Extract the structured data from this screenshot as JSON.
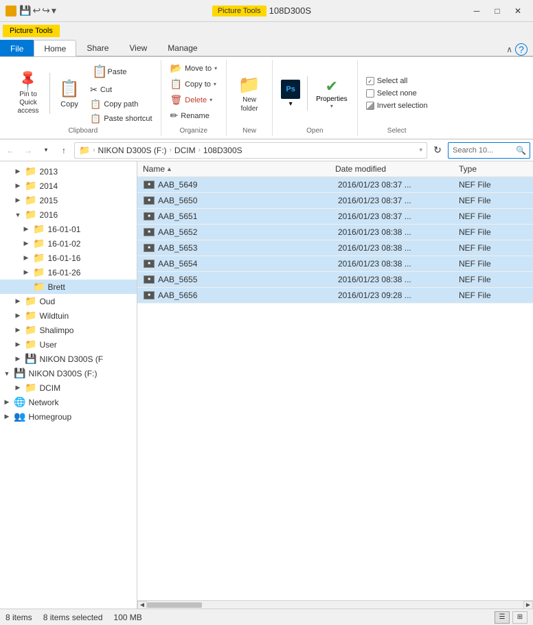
{
  "titlebar": {
    "title": "108D300S",
    "ribbon_label": "Picture Tools",
    "minimize": "─",
    "maximize": "□",
    "close": "✕"
  },
  "ribbon": {
    "tabs": [
      {
        "label": "File",
        "id": "file",
        "type": "file"
      },
      {
        "label": "Home",
        "id": "home",
        "type": "active"
      },
      {
        "label": "Share",
        "id": "share",
        "type": "normal"
      },
      {
        "label": "View",
        "id": "view",
        "type": "normal"
      },
      {
        "label": "Manage",
        "id": "manage",
        "type": "normal"
      }
    ],
    "picture_tools_label": "Picture Tools",
    "groups": {
      "clipboard": {
        "label": "Clipboard",
        "pin_label": "Pin to Quick\naccess",
        "copy_label": "Copy",
        "paste_label": "Paste",
        "cut_label": "Cut",
        "copy_path_label": "Copy path",
        "paste_shortcut_label": "Paste shortcut"
      },
      "organize": {
        "label": "Organize",
        "move_to_label": "Move to",
        "copy_to_label": "Copy to",
        "delete_label": "Delete",
        "rename_label": "Rename"
      },
      "new": {
        "label": "New",
        "new_folder_label": "New\nfolder"
      },
      "open": {
        "label": "Open",
        "properties_label": "Properties"
      },
      "select": {
        "label": "Select",
        "select_all": "Select all",
        "select_none": "Select none",
        "invert_selection": "Invert selection"
      }
    }
  },
  "addressbar": {
    "back_disabled": true,
    "forward_disabled": true,
    "up_label": "Up",
    "path": [
      {
        "label": "NIKON D300S (F:)"
      },
      {
        "label": "DCIM"
      },
      {
        "label": "108D300S"
      }
    ],
    "search_placeholder": "Search 10...",
    "search_icon": "🔍",
    "refresh_icon": "↻"
  },
  "sidebar": {
    "items": [
      {
        "id": "2013",
        "label": "2013",
        "indent": 1,
        "expanded": false,
        "icon": "📁"
      },
      {
        "id": "2014",
        "label": "2014",
        "indent": 1,
        "expanded": false,
        "icon": "📁"
      },
      {
        "id": "2015",
        "label": "2015",
        "indent": 1,
        "expanded": false,
        "icon": "📁"
      },
      {
        "id": "2016",
        "label": "2016",
        "indent": 1,
        "expanded": true,
        "icon": "📁"
      },
      {
        "id": "16-01-01",
        "label": "16-01-01",
        "indent": 2,
        "expanded": false,
        "icon": "📁",
        "color": "orange"
      },
      {
        "id": "16-01-02",
        "label": "16-01-02",
        "indent": 2,
        "expanded": false,
        "icon": "📁",
        "color": "orange"
      },
      {
        "id": "16-01-16",
        "label": "16-01-16",
        "indent": 2,
        "expanded": false,
        "icon": "📁",
        "color": "orange"
      },
      {
        "id": "16-01-26",
        "label": "16-01-26",
        "indent": 2,
        "expanded": false,
        "icon": "📁",
        "color": "orange"
      },
      {
        "id": "Brett",
        "label": "Brett",
        "indent": 2,
        "expanded": false,
        "icon": "📁",
        "selected": true
      },
      {
        "id": "Oud",
        "label": "Oud",
        "indent": 1,
        "expanded": false,
        "icon": "📁"
      },
      {
        "id": "Wildtuin",
        "label": "Wildtuin",
        "indent": 1,
        "expanded": false,
        "icon": "📁"
      },
      {
        "id": "Shalimpo",
        "label": "Shalimpo",
        "indent": 1,
        "expanded": false,
        "icon": "📁",
        "color": "orange"
      },
      {
        "id": "User",
        "label": "User",
        "indent": 1,
        "expanded": false,
        "icon": "📁"
      },
      {
        "id": "nikon-sub",
        "label": "NIKON D300S (F",
        "indent": 1,
        "expanded": false,
        "icon": "💾"
      },
      {
        "id": "nikon-drive",
        "label": "NIKON D300S (F:)",
        "indent": 0,
        "expanded": true,
        "icon": "💾"
      },
      {
        "id": "dcim",
        "label": "DCIM",
        "indent": 1,
        "expanded": false,
        "icon": "📁"
      },
      {
        "id": "network",
        "label": "Network",
        "indent": 0,
        "expanded": false,
        "icon": "🌐"
      },
      {
        "id": "homegroup",
        "label": "Homegroup",
        "indent": 0,
        "expanded": false,
        "icon": "👥"
      }
    ]
  },
  "filelist": {
    "columns": [
      {
        "label": "Name",
        "sort_arrow": "▲"
      },
      {
        "label": "Date modified"
      },
      {
        "label": "Type"
      }
    ],
    "files": [
      {
        "name": "AAB_5649",
        "date": "2016/01/23 08:37 ...",
        "type": "NEF File",
        "selected": true
      },
      {
        "name": "AAB_5650",
        "date": "2016/01/23 08:37 ...",
        "type": "NEF File",
        "selected": true
      },
      {
        "name": "AAB_5651",
        "date": "2016/01/23 08:37 ...",
        "type": "NEF File",
        "selected": true
      },
      {
        "name": "AAB_5652",
        "date": "2016/01/23 08:38 ...",
        "type": "NEF File",
        "selected": true
      },
      {
        "name": "AAB_5653",
        "date": "2016/01/23 08:38 ...",
        "type": "NEF File",
        "selected": true
      },
      {
        "name": "AAB_5654",
        "date": "2016/01/23 08:38 ...",
        "type": "NEF File",
        "selected": true
      },
      {
        "name": "AAB_5655",
        "date": "2016/01/23 08:38 ...",
        "type": "NEF File",
        "selected": true
      },
      {
        "name": "AAB_5656",
        "date": "2016/01/23 09:28 ...",
        "type": "NEF File",
        "selected": true
      }
    ]
  },
  "statusbar": {
    "item_count": "8 items",
    "selected_count": "8 items selected",
    "size": "100 MB"
  }
}
